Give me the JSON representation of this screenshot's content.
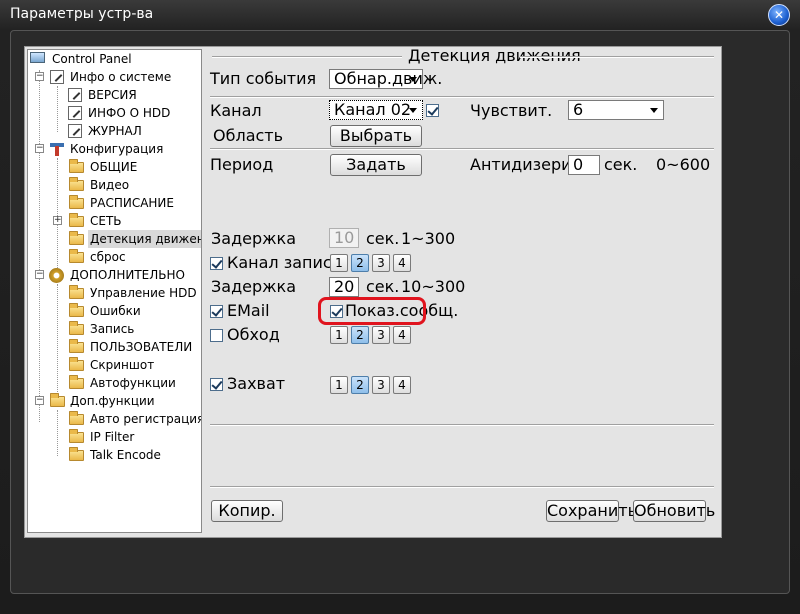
{
  "window": {
    "title": "Параметры устр-ва"
  },
  "tree": {
    "root": "Control Panel",
    "items": [
      {
        "label": "Инфо о системе"
      },
      {
        "label": "ВЕРСИЯ"
      },
      {
        "label": "ИНФО О HDD"
      },
      {
        "label": "ЖУРНАЛ"
      },
      {
        "label": "Конфигурация"
      },
      {
        "label": "ОБЩИЕ"
      },
      {
        "label": "Видео"
      },
      {
        "label": "РАСПИСАНИЕ"
      },
      {
        "label": "СЕТЬ"
      },
      {
        "label": "Детекция движения",
        "selected": true
      },
      {
        "label": "сброс"
      },
      {
        "label": "ДОПОЛНИТЕЛЬНО"
      },
      {
        "label": "Управление HDD"
      },
      {
        "label": "Ошибки"
      },
      {
        "label": "Запись"
      },
      {
        "label": "ПОЛЬЗОВАТЕЛИ"
      },
      {
        "label": "Скриншот"
      },
      {
        "label": "Автофункции"
      },
      {
        "label": "Доп.функции"
      },
      {
        "label": "Авто регистрация"
      },
      {
        "label": "IP Filter"
      },
      {
        "label": "Talk Encode"
      }
    ]
  },
  "panel": {
    "group_title": "Детекция движения",
    "event_type": {
      "label": "Тип события",
      "value": "Обнар.движ."
    },
    "channel": {
      "label": "Канал",
      "value": "Канал 02",
      "checked": true
    },
    "sensitivity": {
      "label": "Чувствит.",
      "value": "6"
    },
    "area": {
      "label": "Область",
      "button": "Выбрать"
    },
    "period": {
      "label": "Период",
      "button": "Задать"
    },
    "antidither": {
      "label": "Антидизеринг",
      "value": "0",
      "unit": "сек.",
      "range": "0~600"
    },
    "delay1": {
      "label": "Задержка",
      "value": "10",
      "unit": "сек.",
      "range": "1~300"
    },
    "record_channel": {
      "label": "Канал записи",
      "checked": true,
      "channels": [
        "1",
        "2",
        "3",
        "4"
      ],
      "active": "2"
    },
    "delay2": {
      "label": "Задержка",
      "value": "20",
      "unit": "сек.",
      "range": "10~300"
    },
    "email": {
      "label": "EMail",
      "checked": true
    },
    "show_message": {
      "label": "Показ.сообщ.",
      "checked": true
    },
    "tour": {
      "label": "Обход",
      "checked": false,
      "channels": [
        "1",
        "2",
        "3",
        "4"
      ],
      "active": "2"
    },
    "snapshot": {
      "label": "Захват",
      "checked": true,
      "channels": [
        "1",
        "2",
        "3",
        "4"
      ],
      "active": "2"
    },
    "buttons": {
      "copy": "Копир.",
      "save": "Сохранить",
      "refresh": "Обновить"
    }
  },
  "colors": {
    "highlight": "#e0141e",
    "active_channel": "#8fbfea"
  }
}
